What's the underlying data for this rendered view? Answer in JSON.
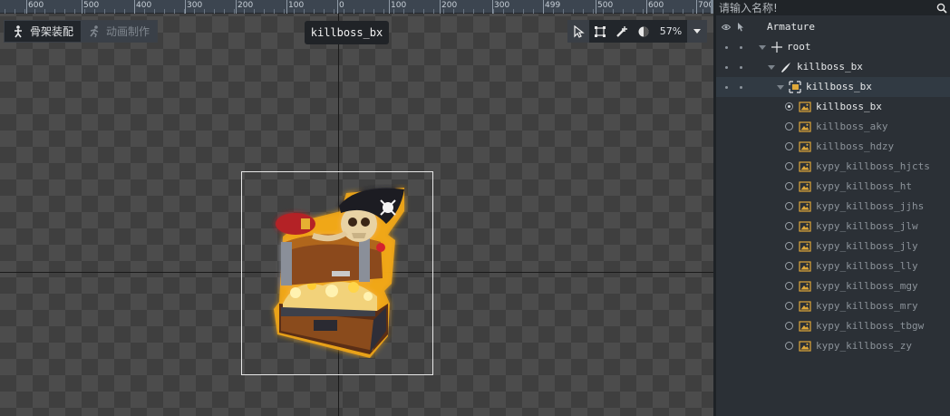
{
  "ruler": {
    "labels": [
      {
        "text": "600"
      },
      {
        "text": "500"
      },
      {
        "text": "400"
      },
      {
        "text": "300"
      },
      {
        "text": "200"
      },
      {
        "text": "100"
      },
      {
        "text": "0"
      },
      {
        "text": "100"
      },
      {
        "text": "200"
      },
      {
        "text": "300"
      },
      {
        "text": "499"
      },
      {
        "text": "500"
      },
      {
        "text": "600"
      },
      {
        "text": "700"
      }
    ]
  },
  "modes": {
    "armature_label": "骨架装配",
    "animation_label": "动画制作"
  },
  "canvas": {
    "title": "killboss_bx"
  },
  "toolbar": {
    "zoom": "57%",
    "tools": [
      "select-arrow-icon",
      "transform-icon",
      "bone-add-icon",
      "onion-skin-icon"
    ]
  },
  "search": {
    "placeholder": "请输入名称!"
  },
  "tree": {
    "header": "Armature",
    "root": "root",
    "bone": "killboss_bx",
    "slot": "killboss_bx",
    "images": [
      {
        "label": "killboss_bx",
        "active": true
      },
      {
        "label": "killboss_aky",
        "active": false
      },
      {
        "label": "killboss_hdzy",
        "active": false
      },
      {
        "label": "kypy_killboss_hjcts",
        "active": false
      },
      {
        "label": "kypy_killboss_ht",
        "active": false
      },
      {
        "label": "kypy_killboss_jjhs",
        "active": false
      },
      {
        "label": "kypy_killboss_jlw",
        "active": false
      },
      {
        "label": "kypy_killboss_jly",
        "active": false
      },
      {
        "label": "kypy_killboss_lly",
        "active": false
      },
      {
        "label": "kypy_killboss_mgy",
        "active": false
      },
      {
        "label": "kypy_killboss_mry",
        "active": false
      },
      {
        "label": "kypy_killboss_tbgw",
        "active": false
      },
      {
        "label": "kypy_killboss_zy",
        "active": false
      }
    ]
  },
  "colors": {
    "panel_bg": "#2b3036",
    "selection_bg": "#313a43",
    "image_icon": "#e0a93a"
  }
}
